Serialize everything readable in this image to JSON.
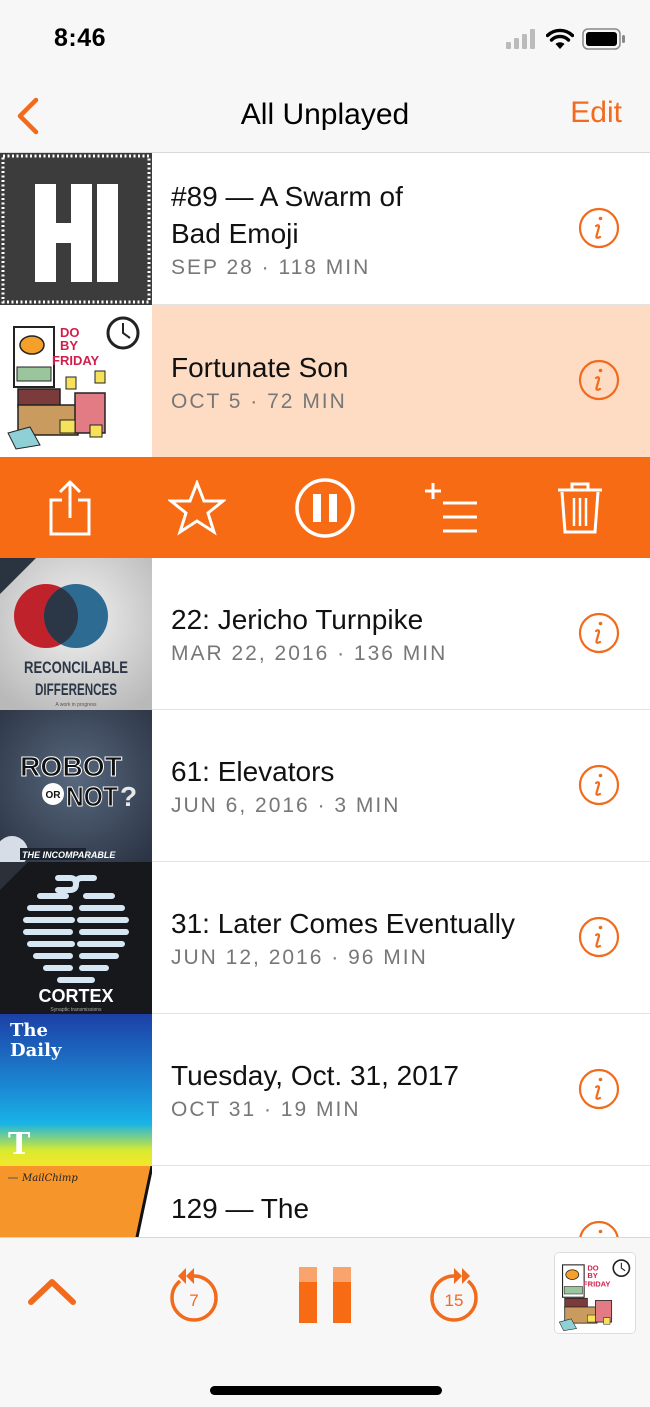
{
  "status": {
    "time": "8:46"
  },
  "nav": {
    "title": "All Unplayed",
    "edit_label": "Edit"
  },
  "accent": "#f26b1d",
  "episodes": [
    {
      "title": "#89 — A Swarm of Bad Emoji",
      "meta": "SEP 28 · 118 MIN",
      "art": "HI"
    },
    {
      "title": "Fortunate Son",
      "meta": "OCT 5 · 72 MIN",
      "art": "DO BY FRIDAY",
      "selected": true
    },
    {
      "title": "22: Jericho Turnpike",
      "meta": "MAR 22, 2016 · 136 MIN",
      "art": "RECONCILABLE DIFFERENCES",
      "art_sub": "A work in progress"
    },
    {
      "title": "61: Elevators",
      "meta": "JUN 6, 2016 · 3 MIN",
      "art": "ROBOT OR NOT?",
      "art_sub": "THE INCOMPARABLE"
    },
    {
      "title": "31: Later Comes Eventually",
      "meta": "JUN 12, 2016 · 96 MIN",
      "art": "CORTEX",
      "art_sub": "Synaptic transmissions"
    },
    {
      "title": "Tuesday, Oct. 31, 2017",
      "meta": "OCT 31 · 19 MIN",
      "art": "The Daily"
    },
    {
      "title": "129 — The",
      "meta": "",
      "art": "MailChimp"
    }
  ],
  "actions": [
    {
      "icon": "share-icon"
    },
    {
      "icon": "star-icon"
    },
    {
      "icon": "pause-circle-icon"
    },
    {
      "icon": "add-to-queue-icon"
    },
    {
      "icon": "trash-icon"
    }
  ],
  "player": {
    "skip_back_seconds": "7",
    "skip_forward_seconds": "15",
    "now_playing_art": "DO BY FRIDAY"
  }
}
